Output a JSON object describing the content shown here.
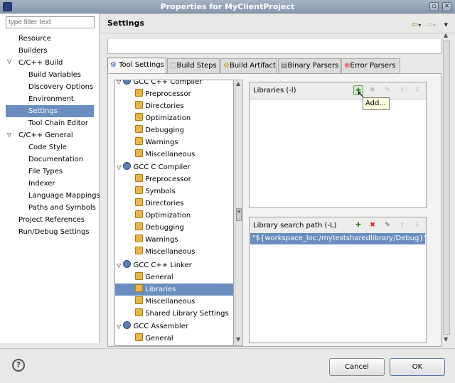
{
  "window": {
    "title": "Properties for MyClientProject"
  },
  "left": {
    "filter_placeholder": "type filter text",
    "items": [
      {
        "label": "Resource"
      },
      {
        "label": "Builders"
      },
      {
        "label": "C/C++ Build"
      },
      {
        "label": "Build Variables"
      },
      {
        "label": "Discovery Options"
      },
      {
        "label": "Environment"
      },
      {
        "label": "Settings"
      },
      {
        "label": "Tool Chain Editor"
      },
      {
        "label": "C/C++ General"
      },
      {
        "label": "Code Style"
      },
      {
        "label": "Documentation"
      },
      {
        "label": "File Types"
      },
      {
        "label": "Indexer"
      },
      {
        "label": "Language Mappings"
      },
      {
        "label": "Paths and Symbols"
      },
      {
        "label": "Project References"
      },
      {
        "label": "Run/Debug Settings"
      }
    ]
  },
  "right": {
    "title": "Settings",
    "nav": {
      "back": "⇦",
      "back_menu": "▾",
      "fwd": "⇨",
      "fwd_menu": "▾",
      "menu": "▾"
    },
    "tabs": [
      {
        "label": "Tool Settings"
      },
      {
        "label": "Build Steps"
      },
      {
        "label": "Build Artifact"
      },
      {
        "label": "Binary Parsers"
      },
      {
        "label": "Error Parsers"
      }
    ],
    "tool_tree": [
      {
        "label": "GCC C++ Compiler"
      },
      {
        "label": "Preprocessor"
      },
      {
        "label": "Directories"
      },
      {
        "label": "Optimization"
      },
      {
        "label": "Debugging"
      },
      {
        "label": "Warnings"
      },
      {
        "label": "Miscellaneous"
      },
      {
        "label": "GCC C Compiler"
      },
      {
        "label": "Preprocessor"
      },
      {
        "label": "Symbols"
      },
      {
        "label": "Directories"
      },
      {
        "label": "Optimization"
      },
      {
        "label": "Debugging"
      },
      {
        "label": "Warnings"
      },
      {
        "label": "Miscellaneous"
      },
      {
        "label": "GCC C++ Linker"
      },
      {
        "label": "General"
      },
      {
        "label": "Libraries"
      },
      {
        "label": "Miscellaneous"
      },
      {
        "label": "Shared Library Settings"
      },
      {
        "label": "GCC Assembler"
      },
      {
        "label": "General"
      }
    ],
    "libraries": {
      "label": "Libraries (-l)",
      "tooltip": "Add..."
    },
    "lib_path": {
      "label": "Library search path (-L)",
      "entries": [
        "\"${workspace_loc:/mytestsharedlibrary/Debug}\""
      ]
    }
  },
  "buttons": {
    "cancel": "Cancel",
    "ok": "OK",
    "help": "?"
  },
  "colors": {
    "selection": "#6a8ebf",
    "title_bar": "#8698ad",
    "tooltip_bg": "#ffffe1"
  }
}
